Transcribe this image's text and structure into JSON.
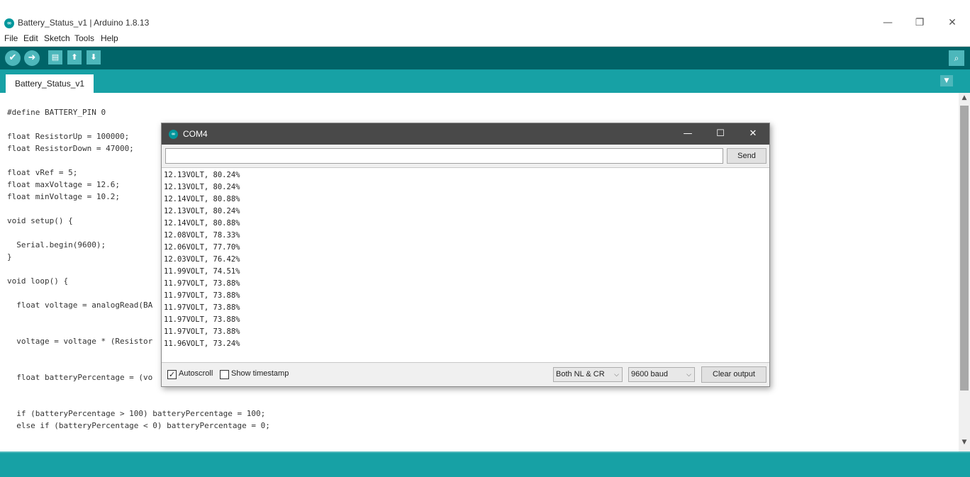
{
  "window": {
    "title": "Battery_Status_v1 | Arduino 1.8.13",
    "logo_text": "∞",
    "minimize_glyph": "—",
    "restore_glyph": "❐",
    "close_glyph": "✕"
  },
  "menu": {
    "items": [
      {
        "label": "File"
      },
      {
        "label": "Edit"
      },
      {
        "label": "Sketch"
      },
      {
        "label": "Tools"
      },
      {
        "label": "Help"
      }
    ]
  },
  "toolbar": {
    "verify_icon": "✔",
    "upload_icon": "➜",
    "new_icon": "▤",
    "open_icon": "⬆",
    "save_icon": "⬇",
    "serial_monitor_icon": "⌕"
  },
  "tabs": {
    "active": "Battery_Status_v1",
    "menu_glyph": "▼"
  },
  "editor": {
    "lines": [
      {
        "text": "#define BATTERY_PIN 0"
      },
      {
        "text": "float ResistorUp = 100000;"
      },
      {
        "text": "float ResistorDown = 47000;"
      },
      {
        "text": "float vRef = 5;"
      },
      {
        "text": "float maxVoltage = 12.6;"
      },
      {
        "text": "float minVoltage = 10.2;"
      },
      {
        "text": "void setup() {"
      },
      {
        "text": "  Serial.begin(9600);"
      },
      {
        "text": "}"
      },
      {
        "text": "void loop() {"
      },
      {
        "text": "  float voltage = analogRead(BA"
      },
      {
        "text": "  voltage = voltage * (Resistor"
      },
      {
        "text": "  float batteryPercentage = (vo"
      },
      {
        "text": "  if (batteryPercentage > 100) batteryPercentage = 100;"
      },
      {
        "text": "  else if (batteryPercentage < 0) batteryPercentage = 0;"
      }
    ],
    "scroll_up": "▲",
    "scroll_down": "▼"
  },
  "serial_monitor": {
    "title": "COM4",
    "logo_text": "∞",
    "minimize_glyph": "—",
    "maximize_glyph": "☐",
    "close_glyph": "✕",
    "input_value": "",
    "send_label": "Send",
    "output": [
      "12.13VOLT, 80.24%",
      "12.13VOLT, 80.24%",
      "12.14VOLT, 80.88%",
      "12.13VOLT, 80.24%",
      "12.14VOLT, 80.88%",
      "12.08VOLT, 78.33%",
      "12.06VOLT, 77.70%",
      "12.03VOLT, 76.42%",
      "11.99VOLT, 74.51%",
      "11.97VOLT, 73.88%",
      "11.97VOLT, 73.88%",
      "11.97VOLT, 73.88%",
      "11.97VOLT, 73.88%",
      "11.97VOLT, 73.88%",
      "11.96VOLT, 73.24%"
    ],
    "autoscroll_label": "Autoscroll",
    "autoscroll_checked": true,
    "autoscroll_mark": "✓",
    "timestamp_label": "Show timestamp",
    "timestamp_checked": false,
    "line_ending": "Both NL & CR",
    "baud_rate": "9600 baud",
    "dropdown_chevron": "⌵",
    "clear_label": "Clear output"
  },
  "colors": {
    "teal_dark": "#006468",
    "teal": "#17a1a5",
    "teal_light": "#4db7bb",
    "keyword": "#5e6d03",
    "function": "#d35400"
  }
}
